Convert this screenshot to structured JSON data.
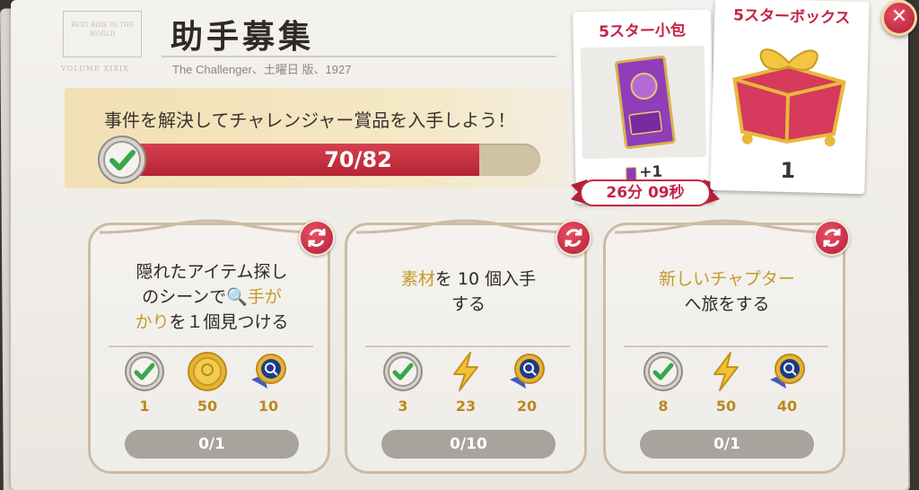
{
  "header": {
    "title": "助手募集",
    "subtitle": "The Challenger、土曜日 版、1927",
    "stamp_text": "BEST RIDE IN THE WORLD",
    "stamp_text2": "VOLUME XIXIX"
  },
  "banner": {
    "text": "事件を解決してチャレンジャー賞品を入手しよう！",
    "progress_text": "70/82",
    "progress_value": 70,
    "progress_max": 82
  },
  "rewards": {
    "small_box": {
      "title": "5スター小包",
      "count": "+1",
      "timer": "26分 09秒"
    },
    "big_box": {
      "title": "5スターボックス",
      "count": "1"
    },
    "close_label": "✕"
  },
  "missions": [
    {
      "text_parts": [
        "隠れたアイテム探し",
        "のシーンで",
        "手が",
        "かり",
        "を１個見つける"
      ],
      "rewards": [
        "1",
        "50",
        "10"
      ],
      "reward_icons": [
        "check-seal-icon",
        "gold-coin-icon",
        "magnifier-medal-icon"
      ],
      "progress": "0/1"
    },
    {
      "text_parts": [
        "素材",
        "を 10 個入手",
        "する"
      ],
      "rewards": [
        "3",
        "23",
        "20"
      ],
      "reward_icons": [
        "check-seal-icon",
        "lightning-icon",
        "magnifier-medal-icon"
      ],
      "progress": "0/10"
    },
    {
      "text_parts": [
        "新しいチャプター",
        "へ旅をする"
      ],
      "rewards": [
        "8",
        "50",
        "40"
      ],
      "reward_icons": [
        "check-seal-icon",
        "lightning-icon",
        "magnifier-medal-icon"
      ],
      "progress": "0/1"
    }
  ],
  "colors": {
    "accent_red": "#c42444",
    "gold": "#c59a28",
    "progress_fill": "#c8303f",
    "banner": "#f3e3ba"
  }
}
